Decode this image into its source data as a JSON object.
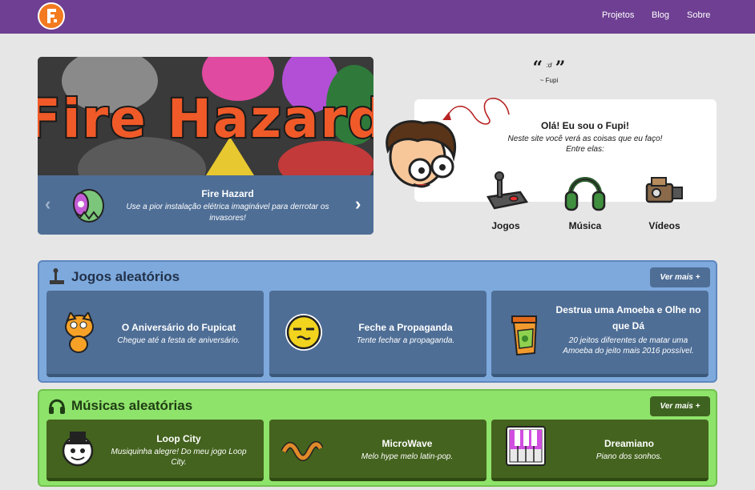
{
  "nav": {
    "logo_alt": "F",
    "links": [
      "Projetos",
      "Blog",
      "Sobre"
    ]
  },
  "carousel": {
    "banner_text": "Fire Hazard",
    "title": "Fire Hazard",
    "description": "Use a pior instalação elétrica imaginável para derrotar os invasores!",
    "prev_icon": "chevron-left-icon",
    "next_icon": "chevron-right-icon"
  },
  "quote": {
    "open": "“",
    "text": ":d",
    "close": "”",
    "author": "~ Fupi"
  },
  "intro": {
    "title": "Olá! Eu sou o Fupi!",
    "subtitle_line1": "Neste site você verá as coisas que eu faço!",
    "subtitle_line2": "Entre elas:",
    "categories": [
      {
        "label": "Jogos",
        "icon": "joystick-icon"
      },
      {
        "label": "Música",
        "icon": "headphones-icon"
      },
      {
        "label": "Vídeos",
        "icon": "camera-icon"
      }
    ]
  },
  "jogos": {
    "title": "Jogos aleatórios",
    "more": "Ver mais +",
    "cards": [
      {
        "title": "O Aniversário do Fupicat",
        "desc": "Chegue até a festa de aniversário.",
        "icon": "scratch-cat-icon"
      },
      {
        "title": "Feche a Propaganda",
        "desc": "Tente fechar a propaganda.",
        "icon": "yellow-face-icon"
      },
      {
        "title": "Destrua uma Amoeba e Olhe no que Dá",
        "desc": "20 jeitos diferentes de matar uma Amoeba do jeito mais 2016 possível.",
        "icon": "amoeba-jar-icon"
      }
    ]
  },
  "musicas": {
    "title": "Músicas aleatórias",
    "more": "Ver mais +",
    "cards": [
      {
        "title": "Loop City",
        "desc": "Musiquinha alegre! Do meu jogo Loop City.",
        "icon": "loop-city-icon"
      },
      {
        "title": "MicroWave",
        "desc": "Melo hype melo latin-pop.",
        "icon": "wave-worm-icon"
      },
      {
        "title": "Dreamiano",
        "desc": "Piano dos sonhos.",
        "icon": "piano-icon"
      }
    ]
  },
  "colors": {
    "navbar": "#6e3f92",
    "jogos_bg": "#7ea9dd",
    "jogos_card": "#4e6e96",
    "musicas_bg": "#8ee36a",
    "musicas_card": "#44631e"
  }
}
